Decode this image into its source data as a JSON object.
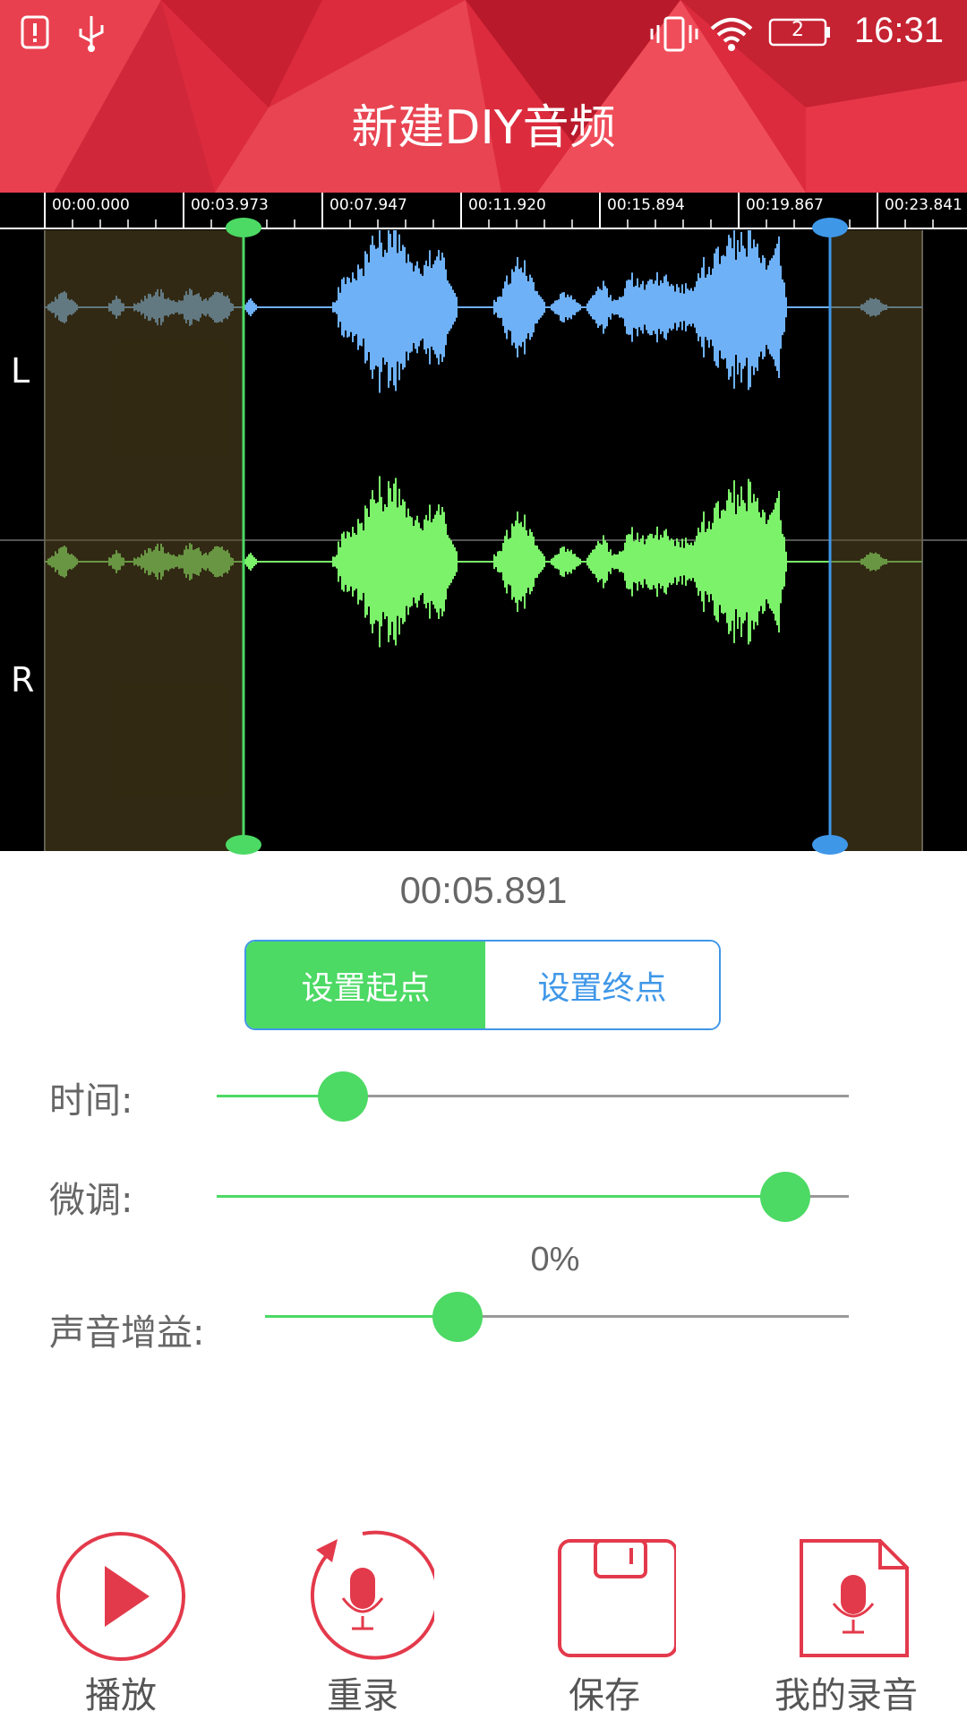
{
  "status_bar": {
    "time": "16:31",
    "icons": [
      "alert-icon",
      "usb-icon",
      "vibrate-icon",
      "wifi-icon",
      "battery-icon"
    ],
    "battery_text": "2"
  },
  "header": {
    "title": "新建DIY音频"
  },
  "ruler": {
    "labels": [
      "00:00.000",
      "00:03.973",
      "00:07.947",
      "00:11.920",
      "00:15.894",
      "00:19.867",
      "00:23.841"
    ]
  },
  "channels": {
    "left": "L",
    "right": "R"
  },
  "colors": {
    "left_wave": "#6eb1f7",
    "right_wave": "#7cf26a",
    "start_marker": "#4cd964",
    "end_marker": "#3f97e8",
    "accent": "#e33a4b"
  },
  "current_time": "00:05.891",
  "segmented": {
    "start_label": "设置起点",
    "end_label": "设置终点",
    "selected": "start"
  },
  "controls": {
    "time_label": "时间:",
    "time_value": 0.2,
    "fine_label": "微调:",
    "fine_value": 0.9,
    "gain_percent": "0%",
    "gain_label": "声音增益:",
    "gain_value": 0.33
  },
  "bottom_bar": {
    "play": "播放",
    "rerecord": "重录",
    "save": "保存",
    "my_recordings": "我的录音"
  }
}
